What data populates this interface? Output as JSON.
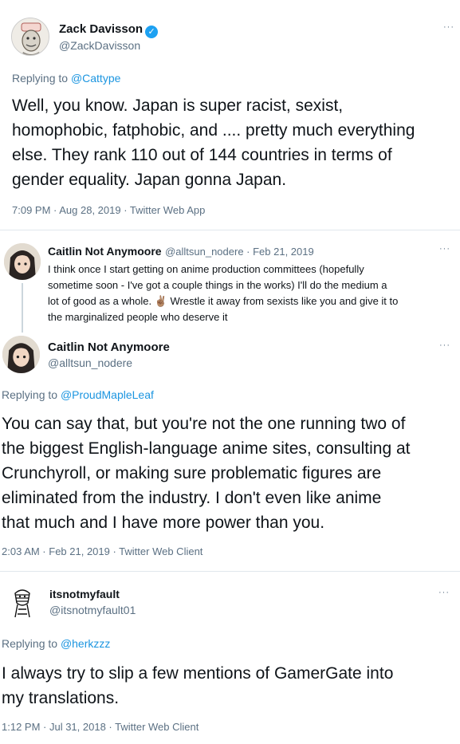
{
  "tweet1": {
    "name": "Zack Davisson",
    "handle": "@ZackDavisson",
    "replying_prefix": "Replying to ",
    "replying_to": "@Cattype",
    "text_lines": [
      "Well, you know. Japan is super racist, sexist,",
      "homophobic, fatphobic, and .... pretty much everything",
      "else. They rank 110 out of 144 countries in terms of",
      "gender equality. Japan gonna Japan."
    ],
    "timestamp": "7:09 PM · Aug 28, 2019 · Twitter Web App"
  },
  "thread_parent": {
    "name": "Caitlin Not Anymoore",
    "handle_date": "@alltsun_nodere · Feb 21, 2019",
    "text_lines": [
      "I think once I start getting on anime production committees (hopefully",
      "sometime soon - I've got a couple things in the works) I'll do the medium a",
      "lot of good as a whole. ✌🏽 Wrestle it away from sexists like you and give it to",
      "the marginalized people who deserve it"
    ]
  },
  "tweet2": {
    "name": "Caitlin Not Anymoore",
    "handle": "@alltsun_nodere",
    "replying_prefix": "Replying to ",
    "replying_to": "@ProudMapleLeaf",
    "text_lines": [
      "You can say that, but you're not the one running two of",
      "the biggest English-language anime sites, consulting at",
      "Crunchyroll, or making sure problematic figures are",
      "eliminated from the industry. I don't even like anime",
      "that much and I have more power than you."
    ],
    "timestamp": "2:03 AM · Feb 21, 2019 · Twitter Web Client"
  },
  "tweet3": {
    "name": "itsnotmyfault",
    "handle": "@itsnotmyfault01",
    "replying_prefix": "Replying to ",
    "replying_to": "@herkzzz",
    "text_lines": [
      "I always try to slip a few mentions of GamerGate into",
      "my translations."
    ],
    "timestamp": "1:12 PM · Jul 31, 2018 · Twitter Web Client"
  },
  "icons": {
    "more": "···",
    "verified": "✓"
  },
  "colors": {
    "link": "#1b95e0",
    "secondary": "#5b7083",
    "verified": "#1da1f2"
  }
}
